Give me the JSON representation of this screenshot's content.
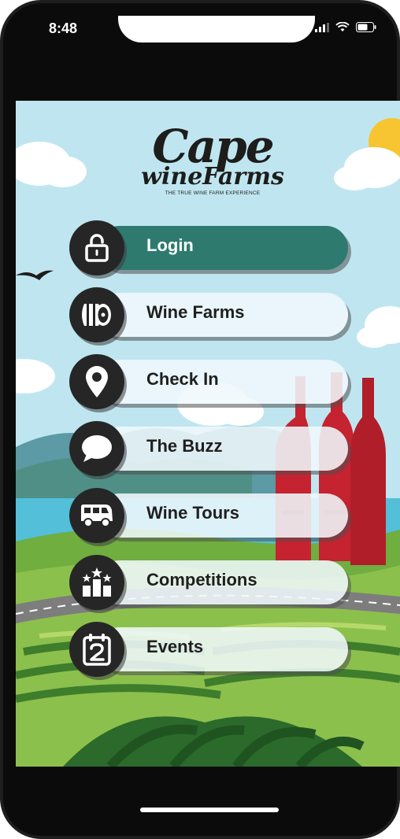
{
  "status_bar": {
    "time": "8:48"
  },
  "logo": {
    "line1": "Cape",
    "line2": "wineFarms",
    "tagline": "THE TRUE WINE FARM EXPERIENCE"
  },
  "menu": [
    {
      "label": "Login",
      "icon": "unlock-icon",
      "active": true
    },
    {
      "label": "Wine Farms",
      "icon": "barrel-icon",
      "active": false
    },
    {
      "label": "Check In",
      "icon": "location-pin-icon",
      "active": false
    },
    {
      "label": "The Buzz",
      "icon": "chat-bubble-icon",
      "active": false
    },
    {
      "label": "Wine Tours",
      "icon": "van-icon",
      "active": false
    },
    {
      "label": "Competitions",
      "icon": "podium-icon",
      "active": false
    },
    {
      "label": "Events",
      "icon": "calendar-icon",
      "active": false
    }
  ],
  "colors": {
    "active_item": "#2f7a6f",
    "icon_circle": "#262626",
    "sky": "#bfe6f0",
    "vineyard_green": "#5e9e3a",
    "bottle_red": "#c4232f"
  }
}
